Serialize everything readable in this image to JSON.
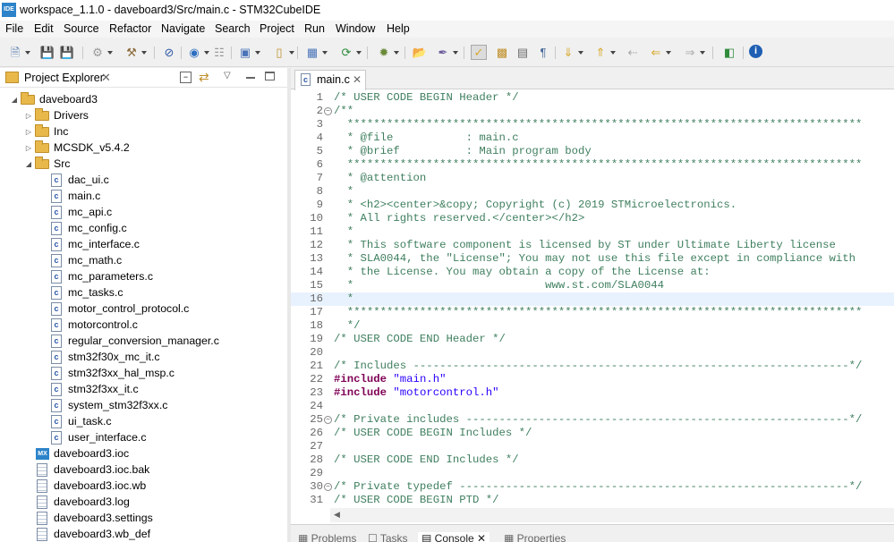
{
  "window": {
    "title": "workspace_1.1.0 - daveboard3/Src/main.c - STM32CubeIDE",
    "icon_label": "IDE"
  },
  "menu": [
    "File",
    "Edit",
    "Source",
    "Refactor",
    "Navigate",
    "Search",
    "Project",
    "Run",
    "Window",
    "Help"
  ],
  "toolbar": {
    "icons": [
      "new-icon",
      "save-icon",
      "save-all-icon",
      "build-settings-icon",
      "hammer-icon",
      "skip-breakpoints-icon",
      "debug-globe-icon",
      "launch-icon",
      "new-project-icon",
      "open-type-icon",
      "new-class-icon",
      "debug-bug-icon",
      "ext-tools-icon",
      "open-folder-icon",
      "search-pen-icon",
      "toggle-mark-icon",
      "block-selection-icon",
      "word-wrap-icon",
      "whitespace-icon",
      "next-annotation-icon",
      "prev-annotation-icon",
      "last-edit-icon",
      "back-icon",
      "forward-icon",
      "pin-editor-icon",
      "info-icon"
    ]
  },
  "project_explorer": {
    "title": "Project Explorer",
    "project": "daveboard3",
    "folders": [
      "Drivers",
      "Inc",
      "MCSDK_v5.4.2",
      "Src"
    ],
    "src_files": [
      "dac_ui.c",
      "main.c",
      "mc_api.c",
      "mc_config.c",
      "mc_interface.c",
      "mc_math.c",
      "mc_parameters.c",
      "mc_tasks.c",
      "motor_control_protocol.c",
      "motorcontrol.c",
      "regular_conversion_manager.c",
      "stm32f30x_mc_it.c",
      "stm32f3xx_hal_msp.c",
      "stm32f3xx_it.c",
      "system_stm32f3xx.c",
      "ui_task.c",
      "user_interface.c"
    ],
    "root_files": [
      {
        "name": "daveboard3.ioc",
        "kind": "mx"
      },
      {
        "name": "daveboard3.ioc.bak",
        "kind": "doc"
      },
      {
        "name": "daveboard3.ioc.wb",
        "kind": "doc"
      },
      {
        "name": "daveboard3.log",
        "kind": "doc"
      },
      {
        "name": "daveboard3.settings",
        "kind": "doc"
      },
      {
        "name": "daveboard3.wb_def",
        "kind": "doc"
      }
    ]
  },
  "editor": {
    "tab": "main.c",
    "lines": [
      {
        "n": "1",
        "text": "/* USER CODE BEGIN Header */"
      },
      {
        "n": "2",
        "text": "/**",
        "fold": true
      },
      {
        "n": "3",
        "text": "  ******************************************************************************"
      },
      {
        "n": "4",
        "text": "  * @file           : main.c"
      },
      {
        "n": "5",
        "text": "  * @brief          : Main program body"
      },
      {
        "n": "6",
        "text": "  ******************************************************************************"
      },
      {
        "n": "7",
        "text": "  * @attention"
      },
      {
        "n": "8",
        "text": "  *"
      },
      {
        "n": "9",
        "text": "  * <h2><center>&copy; Copyright (c) 2019 STMicroelectronics."
      },
      {
        "n": "10",
        "text": "  * All rights reserved.</center></h2>"
      },
      {
        "n": "11",
        "text": "  *"
      },
      {
        "n": "12",
        "text": "  * This software component is licensed by ST under Ultimate Liberty license"
      },
      {
        "n": "13",
        "text": "  * SLA0044, the \"License\"; You may not use this file except in compliance with"
      },
      {
        "n": "14",
        "text": "  * the License. You may obtain a copy of the License at:"
      },
      {
        "n": "15",
        "text": "  *                             www.st.com/SLA0044"
      },
      {
        "n": "16",
        "text": "  *",
        "current": true
      },
      {
        "n": "17",
        "text": "  ******************************************************************************"
      },
      {
        "n": "18",
        "text": "  */"
      },
      {
        "n": "19",
        "text": "/* USER CODE END Header */"
      },
      {
        "n": "20",
        "text": ""
      },
      {
        "n": "21",
        "text": "/* Includes ------------------------------------------------------------------*/"
      },
      {
        "n": "22",
        "text": "#include ",
        "kw": true,
        "str": "\"main.h\""
      },
      {
        "n": "23",
        "text": "#include ",
        "kw": true,
        "str": "\"motorcontrol.h\""
      },
      {
        "n": "24",
        "text": ""
      },
      {
        "n": "25",
        "text": "/* Private includes ----------------------------------------------------------*/",
        "fold": true
      },
      {
        "n": "26",
        "text": "/* USER CODE BEGIN Includes */"
      },
      {
        "n": "27",
        "text": ""
      },
      {
        "n": "28",
        "text": "/* USER CODE END Includes */"
      },
      {
        "n": "29",
        "text": ""
      },
      {
        "n": "30",
        "text": "/* Private typedef -----------------------------------------------------------*/",
        "fold": true
      },
      {
        "n": "31",
        "text": "/* USER CODE BEGIN PTD */"
      }
    ]
  },
  "bottom_tabs": [
    "Problems",
    "Tasks",
    "Console",
    "Properties"
  ],
  "colors": {
    "comment": "#3f7f5f",
    "keyword": "#7f0055",
    "string": "#2a00ff",
    "current_line": "#e8f2fe"
  }
}
